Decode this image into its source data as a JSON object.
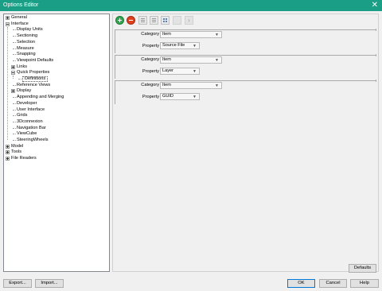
{
  "window": {
    "title": "Options Editor",
    "close_glyph": "✕"
  },
  "tree": {
    "items": [
      {
        "label": "General",
        "level": 0,
        "expander": "plus"
      },
      {
        "label": "Interface",
        "level": 0,
        "expander": "minus"
      },
      {
        "label": "Display Units",
        "level": 1,
        "expander": "none"
      },
      {
        "label": "Sectioning",
        "level": 1,
        "expander": "none"
      },
      {
        "label": "Selection",
        "level": 1,
        "expander": "none"
      },
      {
        "label": "Measure",
        "level": 1,
        "expander": "none"
      },
      {
        "label": "Snapping",
        "level": 1,
        "expander": "none"
      },
      {
        "label": "Viewpoint Defaults",
        "level": 1,
        "expander": "none"
      },
      {
        "label": "Links",
        "level": 1,
        "expander": "plus"
      },
      {
        "label": "Quick Properties",
        "level": 1,
        "expander": "minus"
      },
      {
        "label": "Definitions",
        "level": 2,
        "expander": "none",
        "selected": true
      },
      {
        "label": "Reference Views",
        "level": 1,
        "expander": "none"
      },
      {
        "label": "Display",
        "level": 1,
        "expander": "plus"
      },
      {
        "label": "Appending and Merging",
        "level": 1,
        "expander": "none"
      },
      {
        "label": "Developer",
        "level": 1,
        "expander": "none"
      },
      {
        "label": "User Interface",
        "level": 1,
        "expander": "none"
      },
      {
        "label": "Grids",
        "level": 1,
        "expander": "none"
      },
      {
        "label": "3Dconnexion",
        "level": 1,
        "expander": "none"
      },
      {
        "label": "Navigation Bar",
        "level": 1,
        "expander": "none"
      },
      {
        "label": "ViewCube",
        "level": 1,
        "expander": "none"
      },
      {
        "label": "SteeringWheels",
        "level": 1,
        "expander": "none"
      },
      {
        "label": "Model",
        "level": 0,
        "expander": "plus"
      },
      {
        "label": "Tools",
        "level": 0,
        "expander": "plus"
      },
      {
        "label": "File Readers",
        "level": 0,
        "expander": "plus"
      }
    ]
  },
  "toolbar": {
    "icons": [
      "add-icon",
      "remove-icon",
      "list-icon",
      "list-icon",
      "grid-icon",
      "bar-icon",
      "arrow-right-icon"
    ],
    "arrow_glyph": "›"
  },
  "definitions": [
    {
      "category_label": "Category",
      "category_value": "Item",
      "property_label": "Property",
      "property_value": "Source File"
    },
    {
      "category_label": "Category",
      "category_value": "Item",
      "property_label": "Property",
      "property_value": "Layer"
    },
    {
      "category_label": "Category",
      "category_value": "Item",
      "property_label": "Property",
      "property_value": "GUID"
    }
  ],
  "combo_arrow": "▼",
  "buttons": {
    "defaults": "Defaults",
    "export": "Export...",
    "import": "Import...",
    "ok": "OK",
    "cancel": "Cancel",
    "help": "Help"
  }
}
